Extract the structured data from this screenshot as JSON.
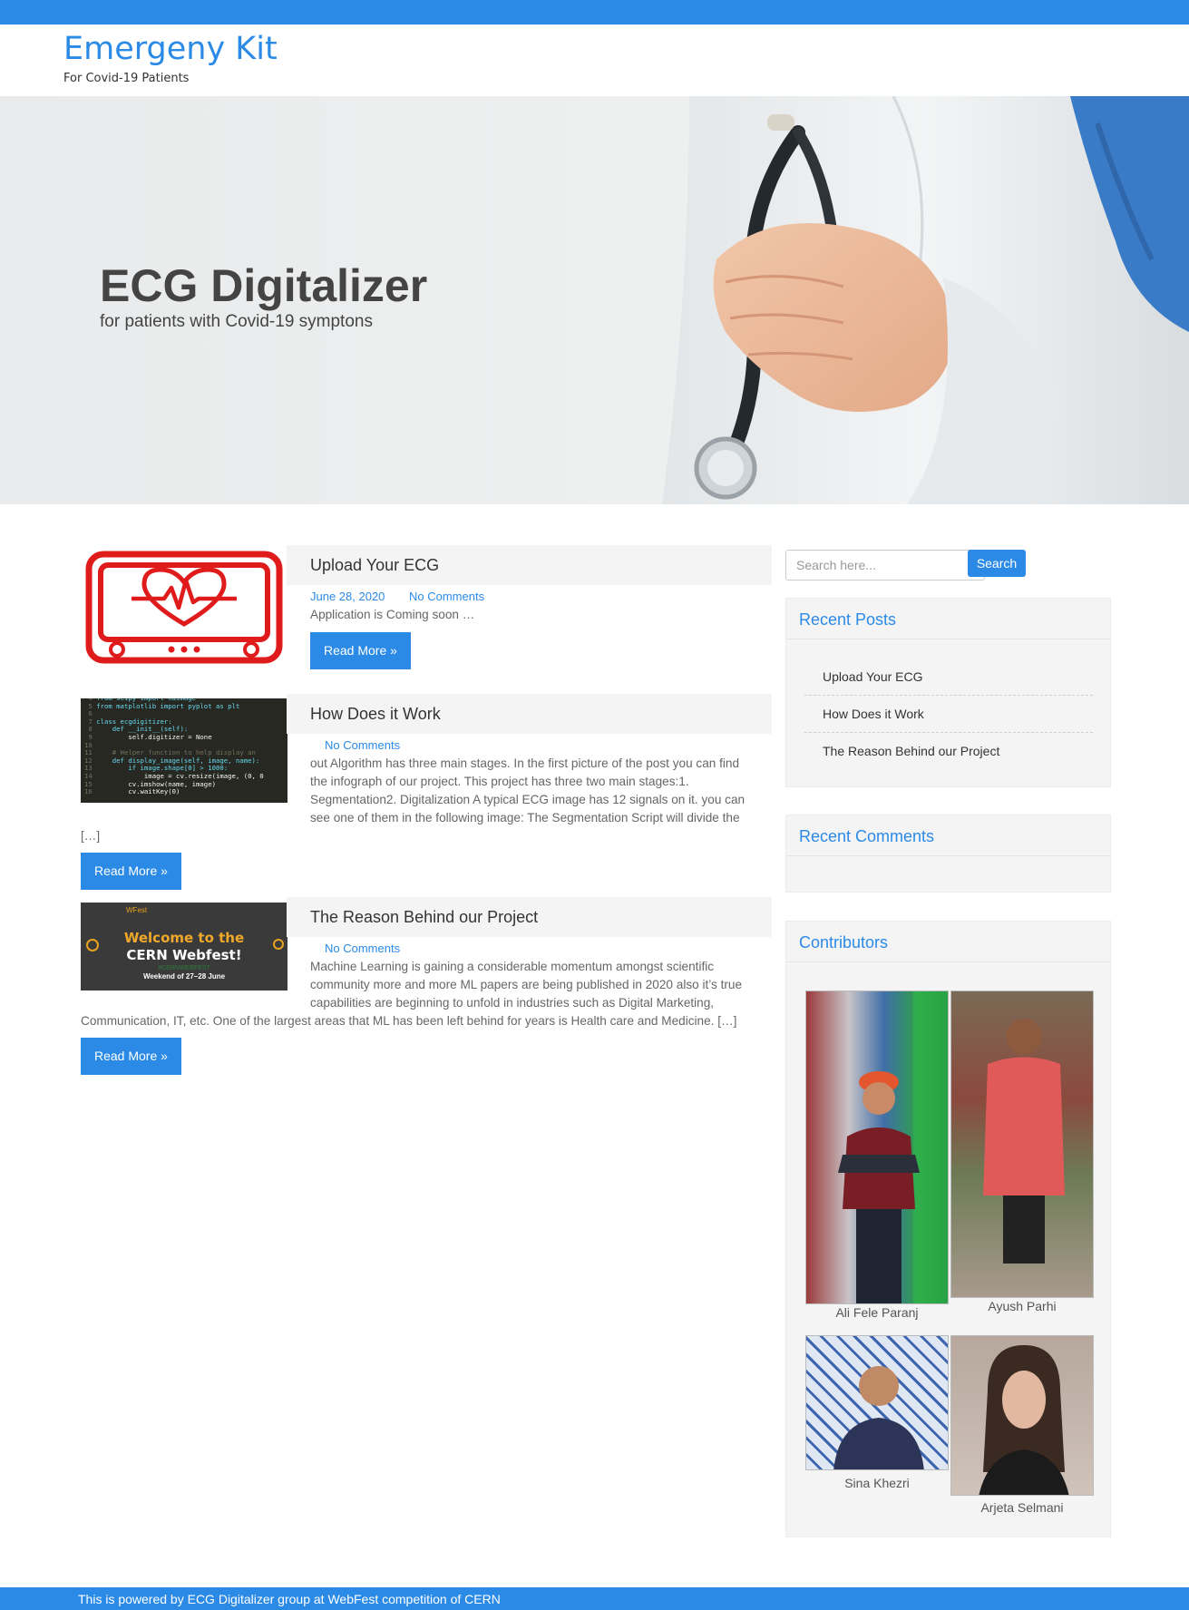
{
  "site": {
    "title": "Emergeny Kit",
    "tagline": "For Covid-19 Patients"
  },
  "hero": {
    "title": "ECG Digitalizer",
    "subtitle": "for patients with Covid-19 symptons"
  },
  "posts": [
    {
      "title": "Upload Your ECG",
      "date": "June 28, 2020",
      "comments": "No Comments",
      "excerpt": "Application is Coming soon …",
      "read_more": "Read More »",
      "thumb_icon": "ecg-monitor-icon"
    },
    {
      "title": "How Does it Work",
      "comments": "No Comments",
      "excerpt_lines": [
        "out Algorithm has three main stages. In the first picture of the post you can find",
        "the infograph of our project. This project has three two main stages:1.",
        "Segmentation2. Digitalization A typical ECG image has 12 signals on it. you can",
        "see one of them in the following image: The Segmentation Script will divide the"
      ],
      "excerpt_tail": "[…]",
      "read_more": "Read More »",
      "code_lines": [
        "from scipy import ndimage",
        "from matplotlib import pyplot as plt",
        "",
        "class ecgdigitizer:",
        "    def __init__(self):",
        "        self.digitizer = None",
        "",
        "    # Helper function to help display an",
        "    def display_image(self, image, name):",
        "        if image.shape[0] > 1000:",
        "            image = cv.resize(image, (0, 0",
        "        cv.imshow(name, image)",
        "        cv.waitKey(0)"
      ]
    },
    {
      "title": "The Reason Behind our Project",
      "comments": "No Comments",
      "excerpt_lines": [
        "Machine Learning is gaining a considerable momentum amongst scientific",
        "community more and more ML papers are being published in 2020 also it’s true",
        "capabilities are beginning to unfold in industries such as Digital Marketing,"
      ],
      "excerpt_tail": "Communication, IT, etc. One of the largest areas that ML has been left behind for years is Health care and Medicine. […]",
      "read_more": "Read More »",
      "banner": {
        "top": "WFest",
        "line1": "Welcome to the",
        "line2": "CERN Webfest!",
        "hashtag": "#CERNWEBFEST",
        "date": "Weekend of 27–28 June"
      }
    }
  ],
  "search": {
    "placeholder": "Search here...",
    "button": "Search"
  },
  "recent_posts": {
    "title": "Recent Posts",
    "items": [
      "Upload Your ECG",
      "How Does it Work",
      "The Reason Behind our Project"
    ]
  },
  "recent_comments": {
    "title": "Recent Comments"
  },
  "contributors": {
    "title": "Contributors",
    "people": [
      "Ali Fele Paranj",
      "Ayush Parhi",
      "Sina Khezri",
      "Arjeta Selmani"
    ]
  },
  "footer": {
    "text": "This is powered by ECG Digitalizer group at WebFest competition of CERN"
  },
  "colors": {
    "accent": "#2a8ae6",
    "panel": "#f5f4f4",
    "ecg_red": "#e01b1b",
    "code_bg": "#272822"
  }
}
